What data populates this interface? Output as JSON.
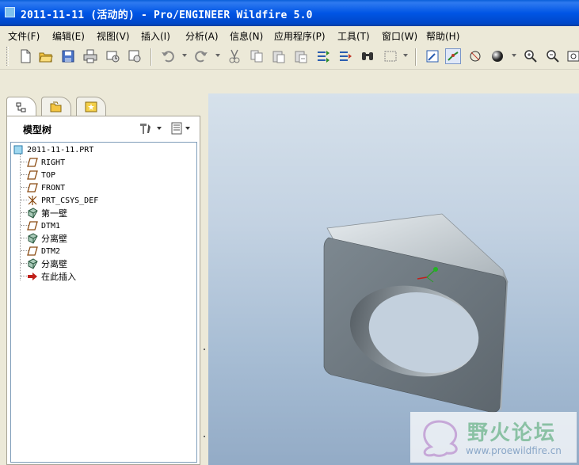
{
  "window": {
    "title": "2011-11-11 (活动的) - Pro/ENGINEER Wildfire 5.0"
  },
  "menu": [
    {
      "label": "文件(F)"
    },
    {
      "label": "编辑(E)"
    },
    {
      "label": "视图(V)"
    },
    {
      "label": "插入(I)"
    },
    {
      "label": "分析(A)"
    },
    {
      "label": "信息(N)"
    },
    {
      "label": "应用程序(P)"
    },
    {
      "label": "工具(T)"
    },
    {
      "label": "窗口(W)"
    },
    {
      "label": "帮助(H)"
    }
  ],
  "toolbar_icons": [
    "new-icon",
    "open-icon",
    "save-icon",
    "print-icon",
    "send-mail-icon",
    "close-window-icon",
    "undo-icon",
    "redo-icon",
    "cut-icon",
    "copy-icon",
    "paste-icon",
    "paste-special-icon",
    "regenerate-icon",
    "regenerate-manager-icon",
    "find-icon",
    "select-box-icon",
    "repaint-icon",
    "spin-center-icon",
    "orient-icon",
    "shading-icon",
    "zoom-in-icon",
    "zoom-out-icon",
    "refit-icon"
  ],
  "left_panel": {
    "tabs": [
      {
        "icon": "model-tree-tab-icon"
      },
      {
        "icon": "folder-browser-tab-icon"
      },
      {
        "icon": "favorites-tab-icon"
      }
    ],
    "tree_title": "模型树",
    "tree": [
      {
        "label": "2011-11-11.PRT",
        "type": "part"
      },
      {
        "label": "RIGHT",
        "type": "datum-plane"
      },
      {
        "label": "TOP",
        "type": "datum-plane"
      },
      {
        "label": "FRONT",
        "type": "datum-plane"
      },
      {
        "label": "PRT_CSYS_DEF",
        "type": "csys"
      },
      {
        "label": "第一壁",
        "type": "wall"
      },
      {
        "label": "DTM1",
        "type": "datum-plane"
      },
      {
        "label": "分离壁",
        "type": "wall"
      },
      {
        "label": "DTM2",
        "type": "datum-plane"
      },
      {
        "label": "分离壁",
        "type": "wall"
      },
      {
        "label": "在此插入",
        "type": "insert-here"
      }
    ]
  },
  "watermark": {
    "text": "野火论坛",
    "url": "www.proewildfire.cn"
  },
  "colors": {
    "titlebar": "#0055e5",
    "viewport_top": "#d6e1eb",
    "viewport_bottom": "#93abc6",
    "model_body": "#6f7a82"
  }
}
